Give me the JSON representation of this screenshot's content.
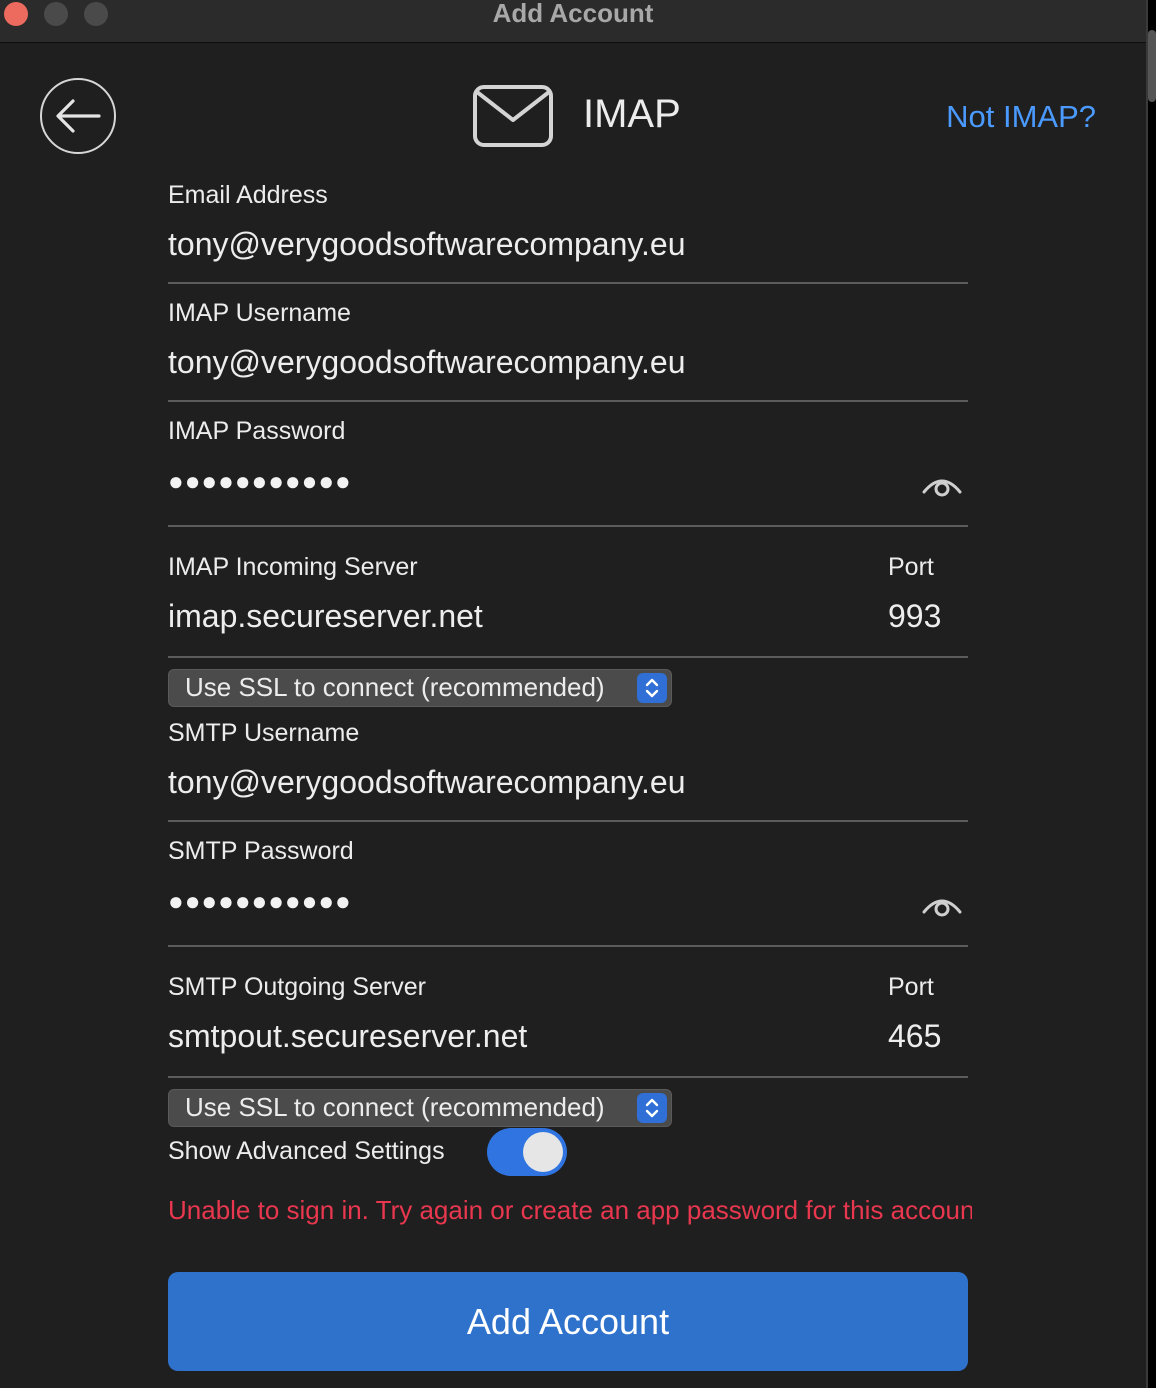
{
  "window": {
    "title": "Add Account"
  },
  "header": {
    "title": "IMAP",
    "alt_link": "Not IMAP?",
    "back_icon": "arrow-left-icon",
    "mail_icon": "envelope-icon"
  },
  "fields": {
    "email_address": {
      "label": "Email Address",
      "value": "tony@verygoodsoftwarecompany.eu"
    },
    "imap_username": {
      "label": "IMAP Username",
      "value": "tony@verygoodsoftwarecompany.eu"
    },
    "imap_password": {
      "label": "IMAP Password",
      "masked": "●●●●●●●●●●●"
    },
    "imap_server": {
      "label": "IMAP Incoming Server",
      "value": "imap.secureserver.net",
      "port_label": "Port",
      "port": "993"
    },
    "imap_ssl": {
      "selected": "Use SSL to connect (recommended)"
    },
    "smtp_username": {
      "label": "SMTP Username",
      "value": "tony@verygoodsoftwarecompany.eu"
    },
    "smtp_password": {
      "label": "SMTP Password",
      "masked": "●●●●●●●●●●●"
    },
    "smtp_server": {
      "label": "SMTP Outgoing Server",
      "value": "smtpout.secureserver.net",
      "port_label": "Port",
      "port": "465"
    },
    "smtp_ssl": {
      "selected": "Use SSL to connect (recommended)"
    }
  },
  "advanced": {
    "label": "Show Advanced Settings",
    "enabled": true
  },
  "error_message": "Unable to sign in. Try again or create an app password for this account.",
  "submit_label": "Add Account",
  "colors": {
    "accent": "#2f72cc",
    "link": "#4a9aff",
    "error": "#e8374e",
    "background": "#1f1f1f"
  }
}
